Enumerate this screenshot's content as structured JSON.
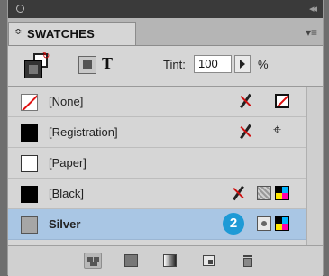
{
  "panel": {
    "tab_label": "SWATCHES",
    "tab_arrows": "≎",
    "collapse_glyph": "◂◂",
    "menu_glyph": "▾≡"
  },
  "toolbar": {
    "text_icon_label": "T",
    "tint_label": "Tint:",
    "tint_value": "100",
    "tint_unit": "%"
  },
  "swatches": [
    {
      "name": "[None]",
      "swatch": "none"
    },
    {
      "name": "[Registration]",
      "swatch": "black"
    },
    {
      "name": "[Paper]",
      "swatch": "paper"
    },
    {
      "name": "[Black]",
      "swatch": "black"
    },
    {
      "name": "Silver",
      "swatch": "silver",
      "selected": true
    }
  ],
  "step_badge": "2",
  "colors": {
    "selection": "#a9c6e4",
    "badge": "#1e9ad6",
    "none_red": "#e01010"
  }
}
